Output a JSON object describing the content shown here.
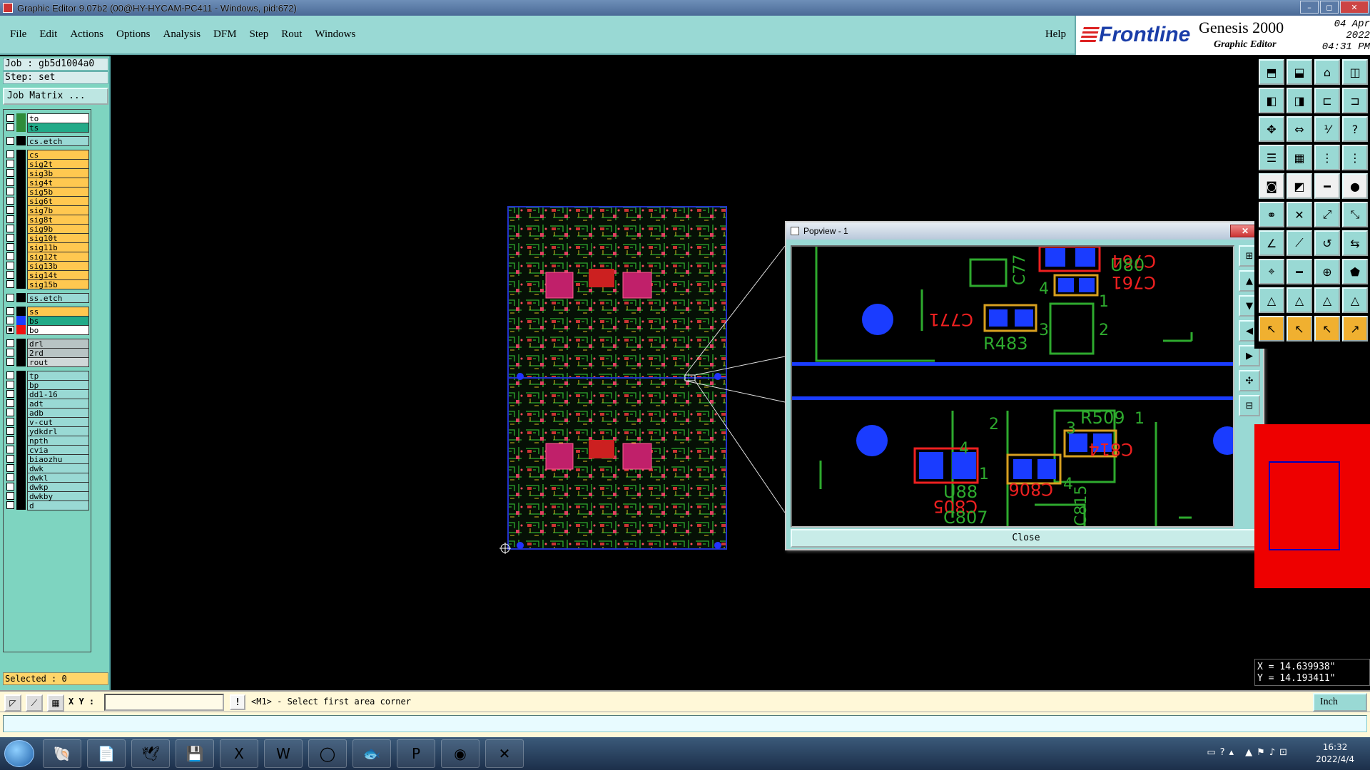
{
  "window": {
    "title": "Graphic Editor 9.07b2 (00@HY-HYCAM-PC411 - Windows, pid:672)",
    "minimize": "–",
    "maximize": "◻",
    "close": "✕"
  },
  "menu": {
    "items": [
      "File",
      "Edit",
      "Actions",
      "Options",
      "Analysis",
      "DFM",
      "Step",
      "Rout",
      "Windows"
    ],
    "help": "Help"
  },
  "brand": {
    "logo": "Frontline",
    "product": "Genesis 2000",
    "subtitle": "Graphic Editor",
    "date": "04 Apr 2022",
    "time": "04:31 PM"
  },
  "left_panel": {
    "job": "Job : gb5d1004a0",
    "step": "Step: set",
    "job_matrix": "Job Matrix ...",
    "selected": "Selected : 0",
    "layers": [
      {
        "name": "to",
        "color": "#2e8b3a",
        "label_bg": "#ffffff"
      },
      {
        "name": "ts",
        "color": "#2e8b3a",
        "label_bg": "#22aa88"
      },
      {
        "name": "cs.etch",
        "color": "#000000",
        "label_bg": "#99d9d4"
      },
      {
        "name": "cs",
        "color": "#000000",
        "label_bg": "#ffc850"
      },
      {
        "name": "sig2t",
        "color": "#000000",
        "label_bg": "#ffc850"
      },
      {
        "name": "sig3b",
        "color": "#000000",
        "label_bg": "#ffc850"
      },
      {
        "name": "sig4t",
        "color": "#000000",
        "label_bg": "#ffc850"
      },
      {
        "name": "sig5b",
        "color": "#000000",
        "label_bg": "#ffc850"
      },
      {
        "name": "sig6t",
        "color": "#000000",
        "label_bg": "#ffc850"
      },
      {
        "name": "sig7b",
        "color": "#000000",
        "label_bg": "#ffc850"
      },
      {
        "name": "sig8t",
        "color": "#000000",
        "label_bg": "#ffc850"
      },
      {
        "name": "sig9b",
        "color": "#000000",
        "label_bg": "#ffc850"
      },
      {
        "name": "sig10t",
        "color": "#000000",
        "label_bg": "#ffc850"
      },
      {
        "name": "sig11b",
        "color": "#000000",
        "label_bg": "#ffc850"
      },
      {
        "name": "sig12t",
        "color": "#000000",
        "label_bg": "#ffc850"
      },
      {
        "name": "sig13b",
        "color": "#000000",
        "label_bg": "#ffc850"
      },
      {
        "name": "sig14t",
        "color": "#000000",
        "label_bg": "#ffc850"
      },
      {
        "name": "sig15b",
        "color": "#000000",
        "label_bg": "#ffc850"
      },
      {
        "name": "ss.etch",
        "color": "#000000",
        "label_bg": "#99d9d4"
      },
      {
        "name": "ss",
        "color": "#000000",
        "label_bg": "#ffc850"
      },
      {
        "name": "bs",
        "color": "#1a3cff",
        "label_bg": "#22aa88"
      },
      {
        "name": "bo",
        "color": "#ee1111",
        "label_bg": "#ffffff"
      },
      {
        "name": "drl",
        "color": "#000000",
        "label_bg": "#b8c4c4"
      },
      {
        "name": "2rd",
        "color": "#000000",
        "label_bg": "#b8c4c4"
      },
      {
        "name": "rout",
        "color": "#000000",
        "label_bg": "#d0d8d8"
      },
      {
        "name": "tp",
        "color": "#000000",
        "label_bg": "#99d9d4"
      },
      {
        "name": "bp",
        "color": "#000000",
        "label_bg": "#99d9d4"
      },
      {
        "name": "dd1-16",
        "color": "#000000",
        "label_bg": "#99d9d4"
      },
      {
        "name": "adt",
        "color": "#000000",
        "label_bg": "#99d9d4"
      },
      {
        "name": "adb",
        "color": "#000000",
        "label_bg": "#99d9d4"
      },
      {
        "name": "v-cut",
        "color": "#000000",
        "label_bg": "#99d9d4"
      },
      {
        "name": "ydkdrl",
        "color": "#000000",
        "label_bg": "#99d9d4"
      },
      {
        "name": "npth",
        "color": "#000000",
        "label_bg": "#99d9d4"
      },
      {
        "name": "cvia",
        "color": "#000000",
        "label_bg": "#99d9d4"
      },
      {
        "name": "biaozhu",
        "color": "#000000",
        "label_bg": "#99d9d4"
      },
      {
        "name": "dwk",
        "color": "#000000",
        "label_bg": "#99d9d4"
      },
      {
        "name": "dwkl",
        "color": "#000000",
        "label_bg": "#99d9d4"
      },
      {
        "name": "dwkp",
        "color": "#000000",
        "label_bg": "#99d9d4"
      },
      {
        "name": "dwkby",
        "color": "#000000",
        "label_bg": "#99d9d4"
      },
      {
        "name": "d",
        "color": "#000000",
        "label_bg": "#99d9d4"
      }
    ]
  },
  "popview": {
    "title": "Popview - 1",
    "close_label": "Close",
    "close_x": "✕",
    "labels": [
      "C764",
      "U80",
      "C761",
      "C771",
      "R483",
      "R509",
      "U88",
      "C805",
      "C806",
      "C807",
      "C814",
      "C815",
      "C77"
    ],
    "pin_numbers": [
      "4",
      "1",
      "3",
      "2",
      "2",
      "3",
      "1",
      "4",
      "1",
      "4"
    ]
  },
  "coords": {
    "x": "X = 14.639938\"",
    "y": "Y = 14.193411\""
  },
  "status": {
    "xy_label": "X Y :",
    "xy_value": "",
    "excl": "!",
    "prompt": "<M1> - Select first area corner",
    "units": "Inch"
  },
  "taskbar": {
    "time": "16:32",
    "date": "2022/4/4"
  }
}
